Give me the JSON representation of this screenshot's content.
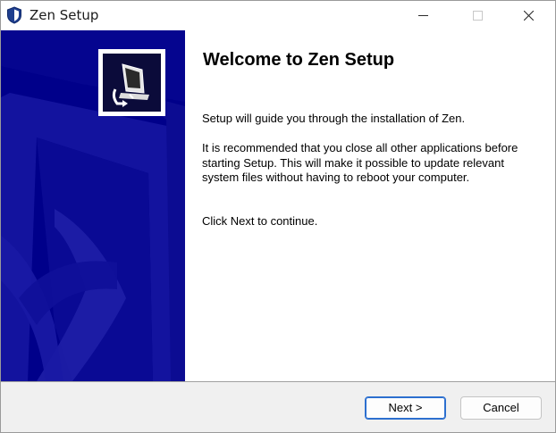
{
  "window": {
    "title": "Zen Setup"
  },
  "titlebar_controls": {
    "minimize_icon": "minimize-icon",
    "maximize_icon": "maximize-icon",
    "close_icon": "close-icon"
  },
  "welcome": {
    "heading": "Welcome to Zen Setup",
    "paragraph_1": "Setup will guide you through the installation of Zen.",
    "paragraph_2": "It is recommended that you close all other applications before starting Setup. This will make it possible to update relevant system files without having to reboot your computer.",
    "paragraph_3": "Click Next to continue."
  },
  "buttons": {
    "next_label": "Next >",
    "cancel_label": "Cancel"
  },
  "colors": {
    "sidebar_bg": "#00008a",
    "accent_border": "#2c6fcf"
  }
}
